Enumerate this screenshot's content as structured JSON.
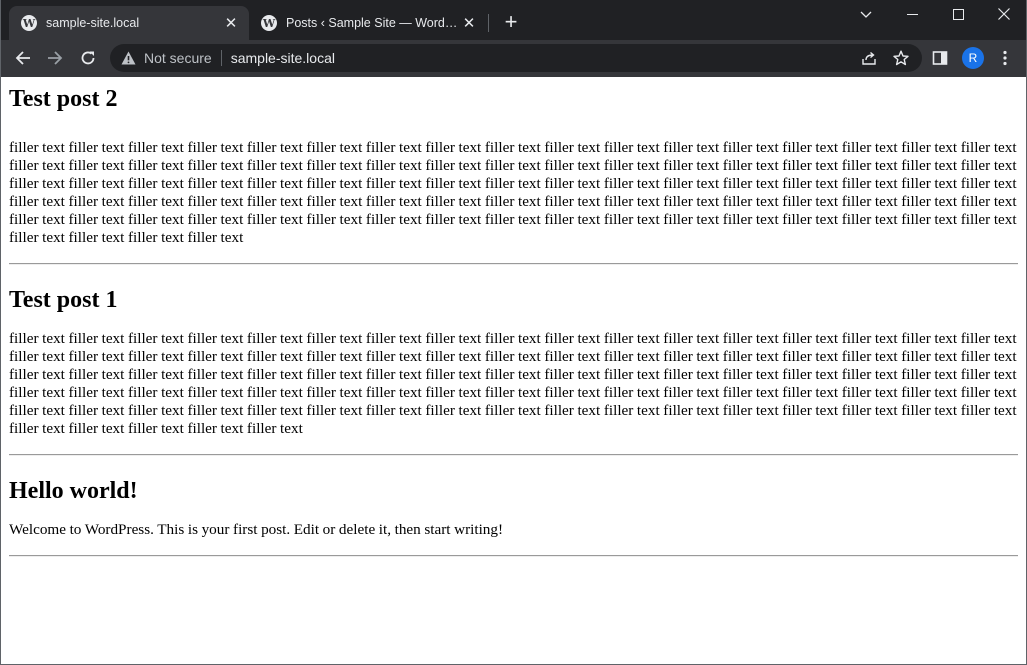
{
  "tabs": [
    {
      "title": "sample-site.local",
      "active": true
    },
    {
      "title": "Posts ‹ Sample Site — WordPress",
      "active": false
    }
  ],
  "toolbar": {
    "security_label": "Not secure",
    "url": "sample-site.local",
    "profile_initial": "R"
  },
  "posts": [
    {
      "title": "Test post 2",
      "body": "filler text filler text filler text filler text filler text filler text filler text filler text filler text filler text filler text filler text filler text filler text filler text filler text filler text filler text filler text filler text filler text filler text filler text filler text filler text filler text filler text filler text filler text filler text filler text filler text filler text filler text filler text filler text filler text filler text filler text filler text filler text filler text filler text filler text filler text filler text filler text filler text filler text filler text filler text filler text filler text filler text filler text filler text filler text filler text filler text filler text filler text filler text filler text filler text filler text filler text filler text filler text filler text filler text filler text filler text filler text filler text filler text filler text filler text filler text filler text filler text filler text filler text filler text filler text filler text filler text filler text filler text filler text"
    },
    {
      "title": "Test post 1",
      "body": "filler text filler text filler text filler text filler text filler text filler text filler text filler text filler text filler text filler text filler text filler text filler text filler text filler text filler text filler text filler text filler text filler text filler text filler text filler text filler text filler text filler text filler text filler text filler text filler text filler text filler text filler text filler text filler text filler text filler text filler text filler text filler text filler text filler text filler text filler text filler text filler text filler text filler text filler text filler text filler text filler text filler text filler text filler text filler text filler text filler text filler text filler text filler text filler text filler text filler text filler text filler text filler text filler text filler text filler text filler text filler text filler text filler text filler text filler text filler text filler text filler text filler text filler text filler text filler text filler text filler text filler text filler text filler text"
    },
    {
      "title": "Hello world!",
      "body": "Welcome to WordPress. This is your first post. Edit or delete it, then start writing!"
    }
  ],
  "colors": {
    "tabstrip": "#202124",
    "toolbar": "#35363a",
    "page_bg": "#ffffff",
    "avatar": "#1a73e8"
  }
}
